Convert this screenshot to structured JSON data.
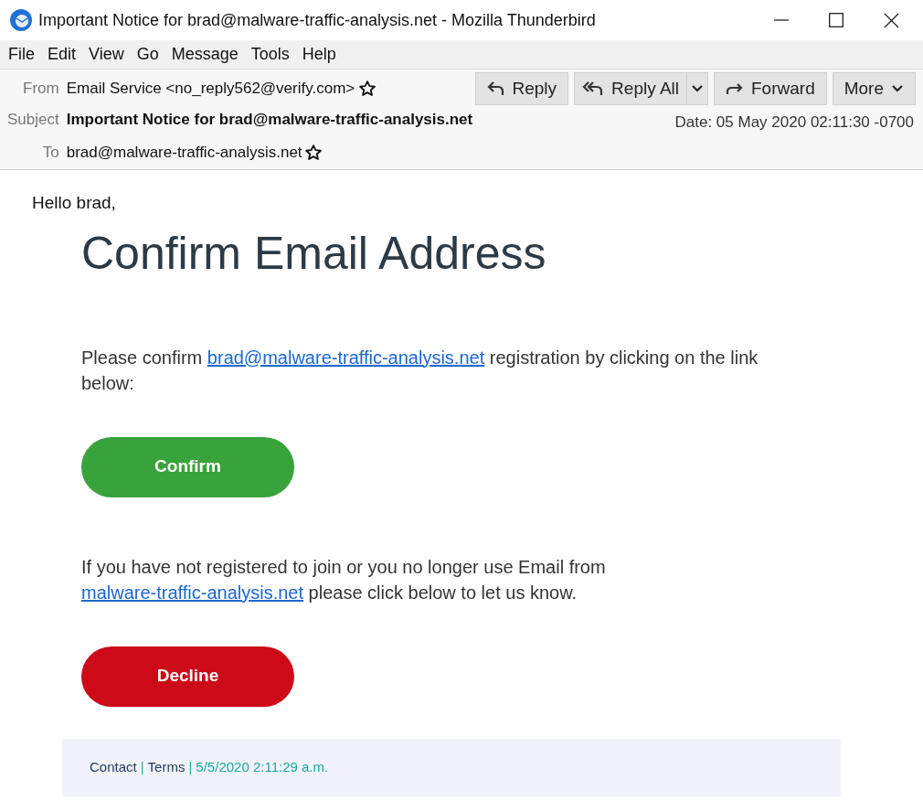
{
  "window": {
    "title": "Important Notice for brad@malware-traffic-analysis.net - Mozilla Thunderbird"
  },
  "menu": [
    "File",
    "Edit",
    "View",
    "Go",
    "Message",
    "Tools",
    "Help"
  ],
  "header": {
    "from_label": "From",
    "from": "Email Service <no_reply562@verify.com>",
    "subject_label": "Subject",
    "subject": "Important Notice for brad@malware-traffic-analysis.net",
    "to_label": "To",
    "to": "brad@malware-traffic-analysis.net",
    "date": "Date: 05 May 2020 02:11:30 -0700"
  },
  "actions": [
    {
      "label": "Reply",
      "kind": "reply"
    },
    {
      "label": "Reply All",
      "kind": "reply-all"
    },
    {
      "label": "Forward",
      "kind": "forward"
    },
    {
      "label": "More",
      "kind": "more"
    }
  ],
  "body": {
    "greeting": "Hello brad,",
    "heading": "Confirm Email Address",
    "paragraph_1": {
      "before": "Please confirm ",
      "link": "brad@malware-traffic-analysis.net",
      "after": "  registration by clicking on the link below:"
    },
    "confirm_button": "Confirm",
    "paragraph_2": {
      "before": "If you have not registered to join or you no longer use Email from ",
      "link": "malware-traffic-analysis.net",
      "after": " please click below  to let us know."
    },
    "decline_button": "Decline",
    "footer": {
      "contact": "Contact",
      "sep_1": "|",
      "terms": "Terms",
      "sep_2": "|",
      "timestamp": "5/5/2020 2:11:29 a.m."
    }
  }
}
